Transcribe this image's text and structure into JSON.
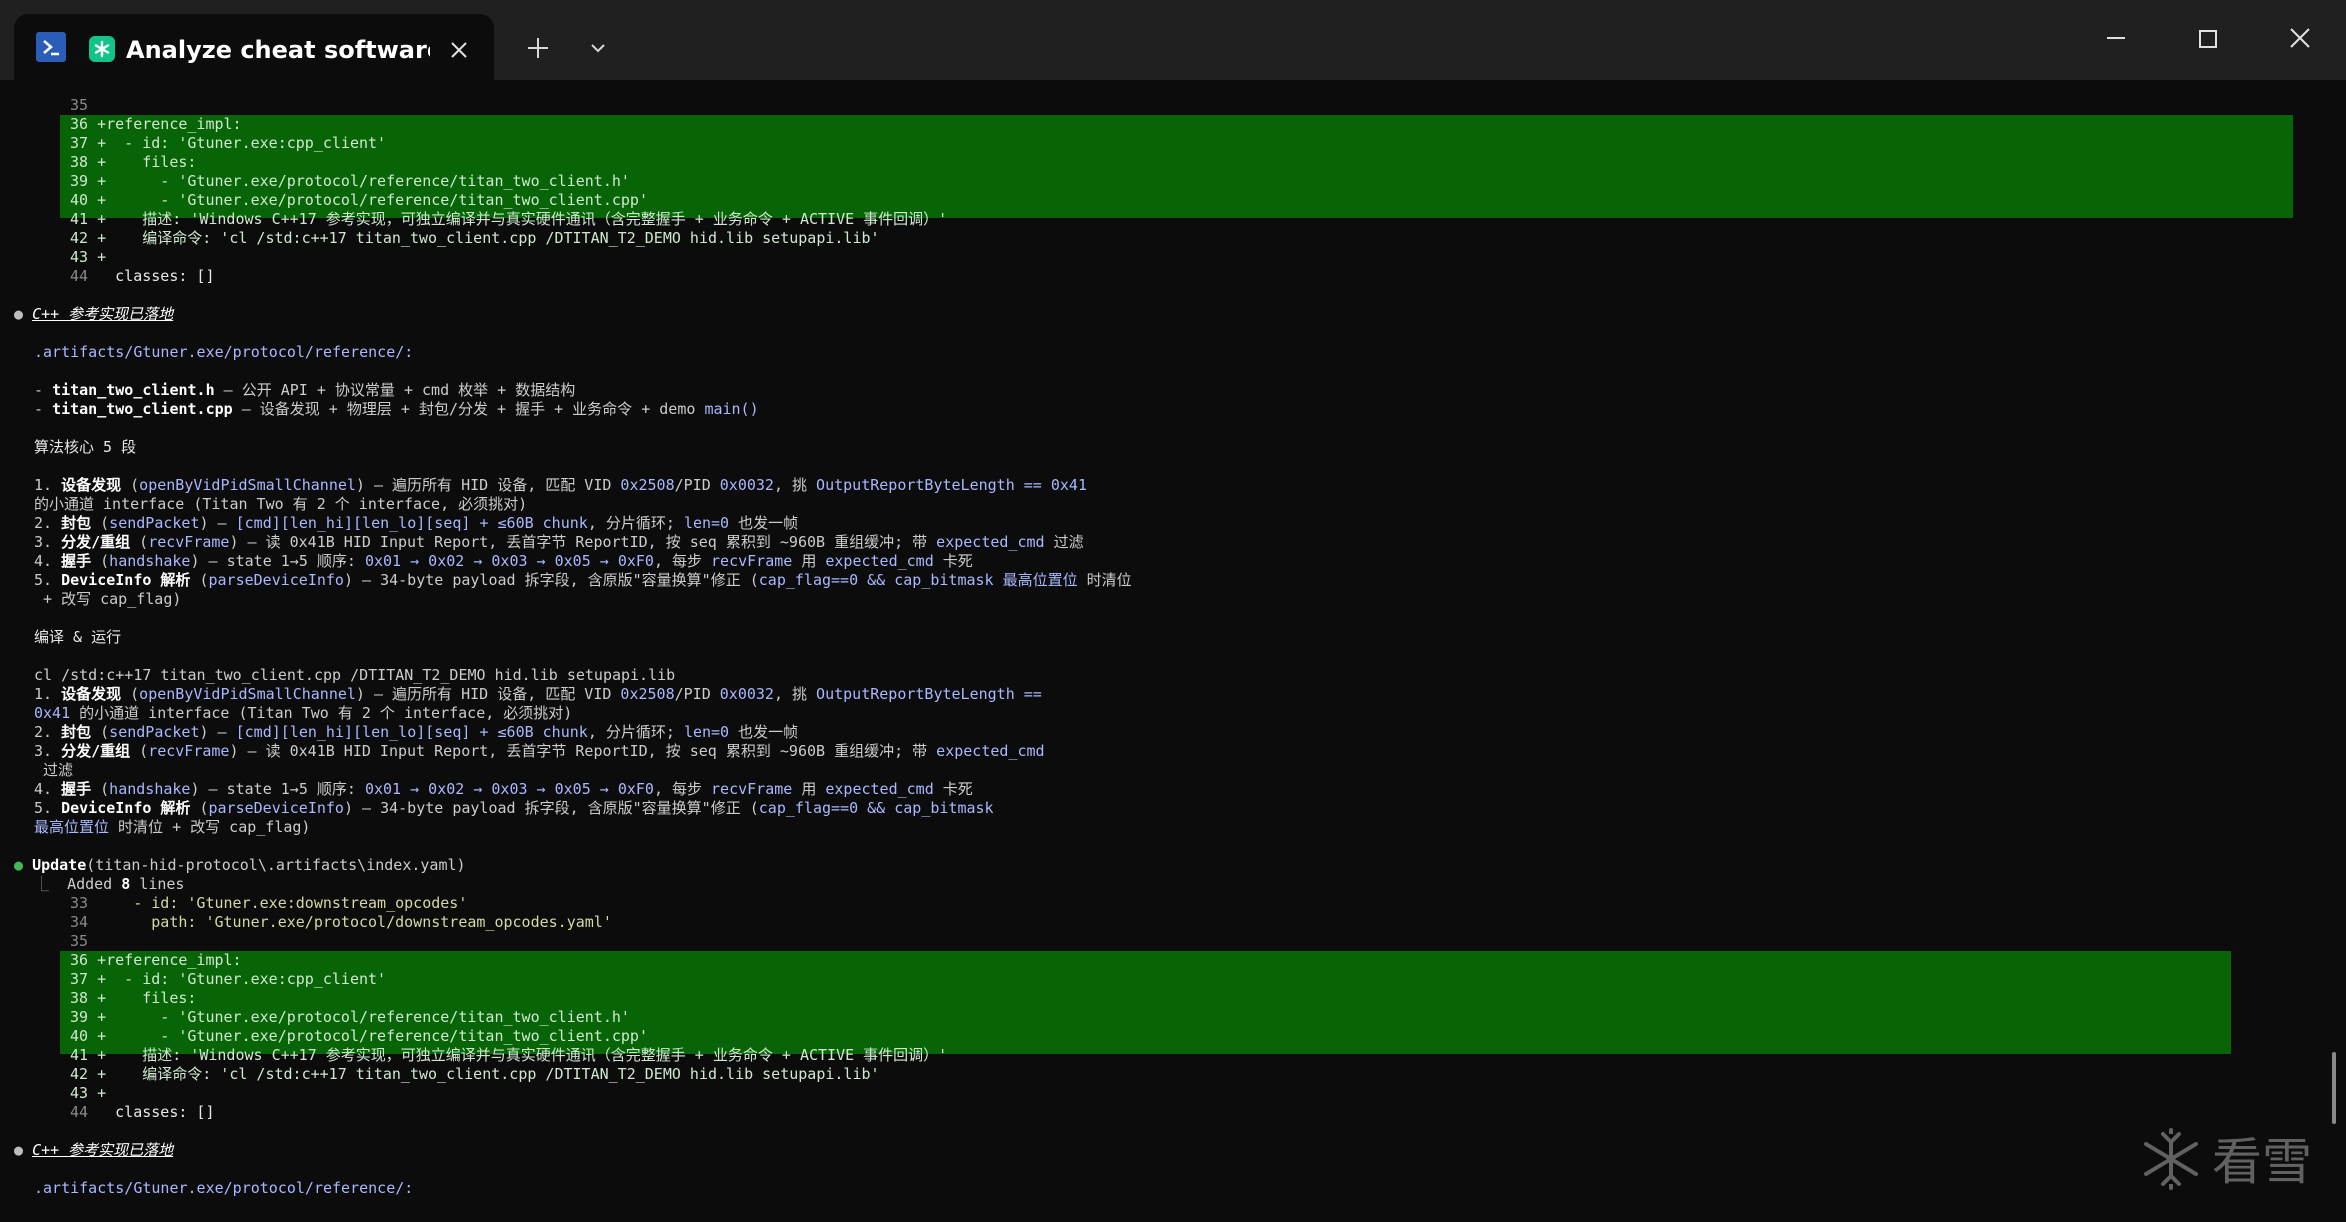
{
  "window": {
    "tab_title": "Analyze cheat software har",
    "icons": {
      "shell": "powershell-icon",
      "app": "claude-asterisk-icon",
      "close_tab": "close-icon",
      "new_tab": "plus-icon",
      "dropdown": "chevron-down-icon",
      "minimize": "minimize-icon",
      "maximize": "maximize-icon",
      "close_window": "close-icon"
    }
  },
  "colors": {
    "background": "#0c0c0c",
    "titlebar": "#202020",
    "diff_added_bg": "#076507",
    "accent_blue": "#a9b8ff"
  },
  "diff": {
    "line_35": "35",
    "line_36": "36 +reference_impl:",
    "line_37_n": "37 +",
    "line_37": "  - id: 'Gtuner.exe:cpp_client'",
    "line_38_n": "38 +",
    "line_38": "    files:",
    "line_39_n": "39 +",
    "line_39": "      - 'Gtuner.exe/protocol/reference/titan_two_client.h'",
    "line_40_n": "40 +",
    "line_40": "      - 'Gtuner.exe/protocol/reference/titan_two_client.cpp'",
    "line_41_n": "41 +",
    "line_41": "    描述: 'Windows C++17 参考实现，可独立编译并与真实硬件通讯（含完整握手 + 业务命令 + ACTIVE 事件回调）'",
    "line_42_n": "42 +",
    "line_42": "    编译命令: 'cl /std:c++17 titan_two_client.cpp /DTITAN_T2_DEMO hid.lib setupapi.lib'",
    "line_43": "43 +",
    "line_44_n": "44",
    "line_44": "classes: []"
  },
  "msg1": {
    "title": "C++ 参考实现已落地",
    "path": ".artifacts/Gtuner.exe/protocol/reference/:",
    "file_h": "titan_two_client.h",
    "file_h_desc": " — 公开 API + 协议常量 + cmd 枚举 + 数据结构",
    "file_cpp": "titan_two_client.cpp",
    "file_cpp_desc_a": " — 设备发现 + 物理层 + 封包/分发 + 握手 + 业务命令 + demo ",
    "file_cpp_desc_b": "main()",
    "algo_heading": "算法核心 5 段",
    "s1_a": "设备发现",
    "s1_b": " (",
    "s1_c": "openByVidPidSmallChannel",
    "s1_d": ") — 遍历所有 HID 设备, 匹配 VID ",
    "s1_e": "0x2508",
    "s1_f": "/PID ",
    "s1_g": "0x0032",
    "s1_h": ", 挑 ",
    "s1_i": "OutputReportByteLength == 0x41",
    "s1_cont": "的小通道 interface (Titan Two 有 2 个 interface, 必须挑对)",
    "s2_a": "封包",
    "s2_b": " (",
    "s2_c": "sendPacket",
    "s2_d": ") — ",
    "s2_e": "[cmd][len_hi][len_lo][seq] + ≤60B chunk",
    "s2_f": ", 分片循环; ",
    "s2_g": "len=0",
    "s2_h": " 也发一帧",
    "s3_a": "分发/重组",
    "s3_b": " (",
    "s3_c": "recvFrame",
    "s3_d": ") — 读 0x41B HID Input Report, 丢首字节 ReportID, 按 seq 累积到 ~960B 重组缓冲; 带 ",
    "s3_e": "expected_cmd",
    "s3_f": " 过滤",
    "s4_a": "握手",
    "s4_b": " (",
    "s4_c": "handshake",
    "s4_d": ") — state 1→5 顺序: ",
    "s4_e": "0x01 → 0x02 → 0x03 → 0x05 → 0xF0",
    "s4_f": ", 每步 ",
    "s4_g": "recvFrame",
    "s4_h": " 用 ",
    "s4_i": "expected_cmd",
    "s4_j": " 卡死",
    "s5_a": "DeviceInfo 解析",
    "s5_b": " (",
    "s5_c": "parseDeviceInfo",
    "s5_d": ") — 34-byte payload 拆字段, 含原版\"容量换算\"修正 (",
    "s5_e": "cap_flag==0 && cap_bitmask 最高位置位",
    "s5_f": " 时清位",
    "s5_cont": " + 改写 cap_flag)",
    "build_heading": "编译 & 运行",
    "build_cmd": "cl /std:c++17 titan_two_client.cpp /DTITAN_T2_DEMO hid.lib setupapi.lib",
    "r1_wrap_a": "OutputReportByteLength ==",
    "r1_cont_a": "0x41",
    "r1_cont_b": " 的小通道 interface (Titan Two 有 2 个 interface, 必须挑对)",
    "r3_cont": " 过滤",
    "r5_d": ") — 34-byte payload 拆字段, 含原版\"容量换算\"修正 (",
    "r5_e": "cap_flag==0 && cap_bitmask",
    "r5_cont_a": "最高位置位",
    "r5_cont_b": " 时清位 + 改写 cap_flag)"
  },
  "update": {
    "label": "Update",
    "target": "(titan-hid-protocol\\.artifacts\\index.yaml)",
    "added_prefix": "Added ",
    "added_count": "8",
    "added_suffix": " lines",
    "l33_n": "33",
    "l33": "  - id: 'Gtuner.exe:downstream_opcodes'",
    "l34_n": "34",
    "l34": "    path: 'Gtuner.exe/protocol/downstream_opcodes.yaml'",
    "l35": "35"
  },
  "watermark": {
    "text": "看雪",
    "icon": "snowflake-icon"
  }
}
